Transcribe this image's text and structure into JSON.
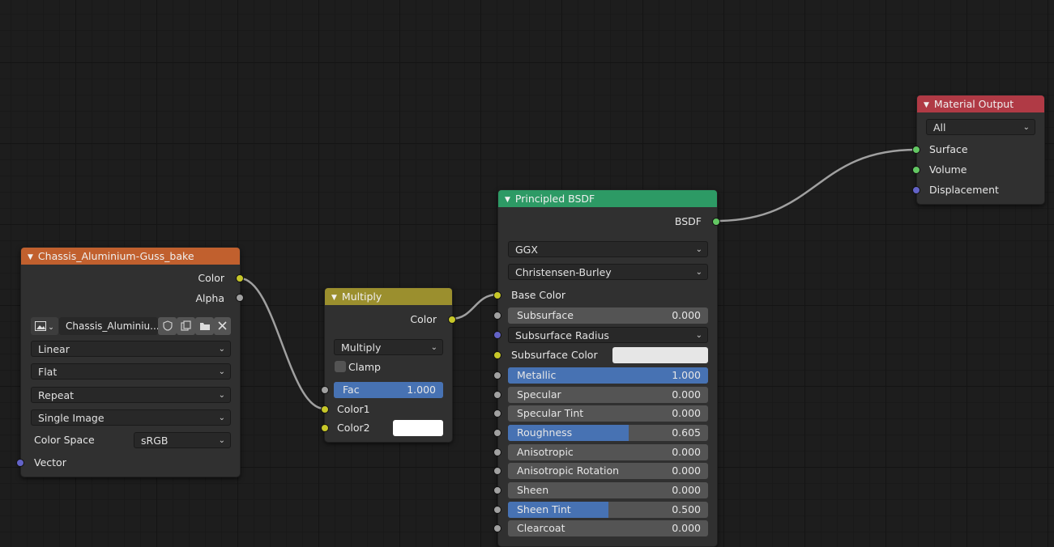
{
  "image_node": {
    "title": "Chassis_Aluminium-Guss_bake",
    "outputs": {
      "color": "Color",
      "alpha": "Alpha"
    },
    "image_name": "Chassis_Aluminiu...",
    "interpolation": "Linear",
    "projection": "Flat",
    "extension": "Repeat",
    "source": "Single Image",
    "color_space_label": "Color Space",
    "color_space_value": "sRGB",
    "input_vector": "Vector",
    "header_color": "#c1602e"
  },
  "mix_node": {
    "title": "Multiply",
    "output_color": "Color",
    "blend_mode": "Multiply",
    "clamp_label": "Clamp",
    "clamp_checked": false,
    "fac_label": "Fac",
    "fac_value": "1.000",
    "fac_fraction": 1.0,
    "color1": "Color1",
    "color2": "Color2",
    "color2_swatch": "#ffffff",
    "header_color": "#9b8f2e"
  },
  "bsdf_node": {
    "title": "Principled BSDF",
    "output_bsdf": "BSDF",
    "distribution": "GGX",
    "subsurface_method": "Christensen-Burley",
    "base_color": "Base Color",
    "subsurface": {
      "label": "Subsurface",
      "value": "0.000",
      "fraction": 0.0
    },
    "subsurface_radius": "Subsurface Radius",
    "subsurface_color": "Subsurface Color",
    "subsurface_color_swatch": "#e6e6e6",
    "metallic": {
      "label": "Metallic",
      "value": "1.000",
      "fraction": 1.0
    },
    "specular": {
      "label": "Specular",
      "value": "0.000",
      "fraction": 0.0
    },
    "specular_tint": {
      "label": "Specular Tint",
      "value": "0.000",
      "fraction": 0.0
    },
    "roughness": {
      "label": "Roughness",
      "value": "0.605",
      "fraction": 0.605
    },
    "anisotropic": {
      "label": "Anisotropic",
      "value": "0.000",
      "fraction": 0.0
    },
    "anisotropic_rotation": {
      "label": "Anisotropic Rotation",
      "value": "0.000",
      "fraction": 0.0
    },
    "sheen": {
      "label": "Sheen",
      "value": "0.000",
      "fraction": 0.0
    },
    "sheen_tint": {
      "label": "Sheen Tint",
      "value": "0.500",
      "fraction": 0.5
    },
    "clearcoat": {
      "label": "Clearcoat",
      "value": "0.000",
      "fraction": 0.0
    },
    "header_color": "#2d9a65"
  },
  "output_node": {
    "title": "Material Output",
    "target": "All",
    "surface": "Surface",
    "volume": "Volume",
    "displacement": "Displacement",
    "header_color": "#b03a45"
  },
  "colors": {
    "background": "#1d1d1d",
    "node_body": "#303030",
    "slider_fill": "#4772b3",
    "socket_color": "#c7c729",
    "socket_float": "#a1a1a1",
    "socket_shader": "#63c763",
    "socket_vector": "#6363c7"
  }
}
